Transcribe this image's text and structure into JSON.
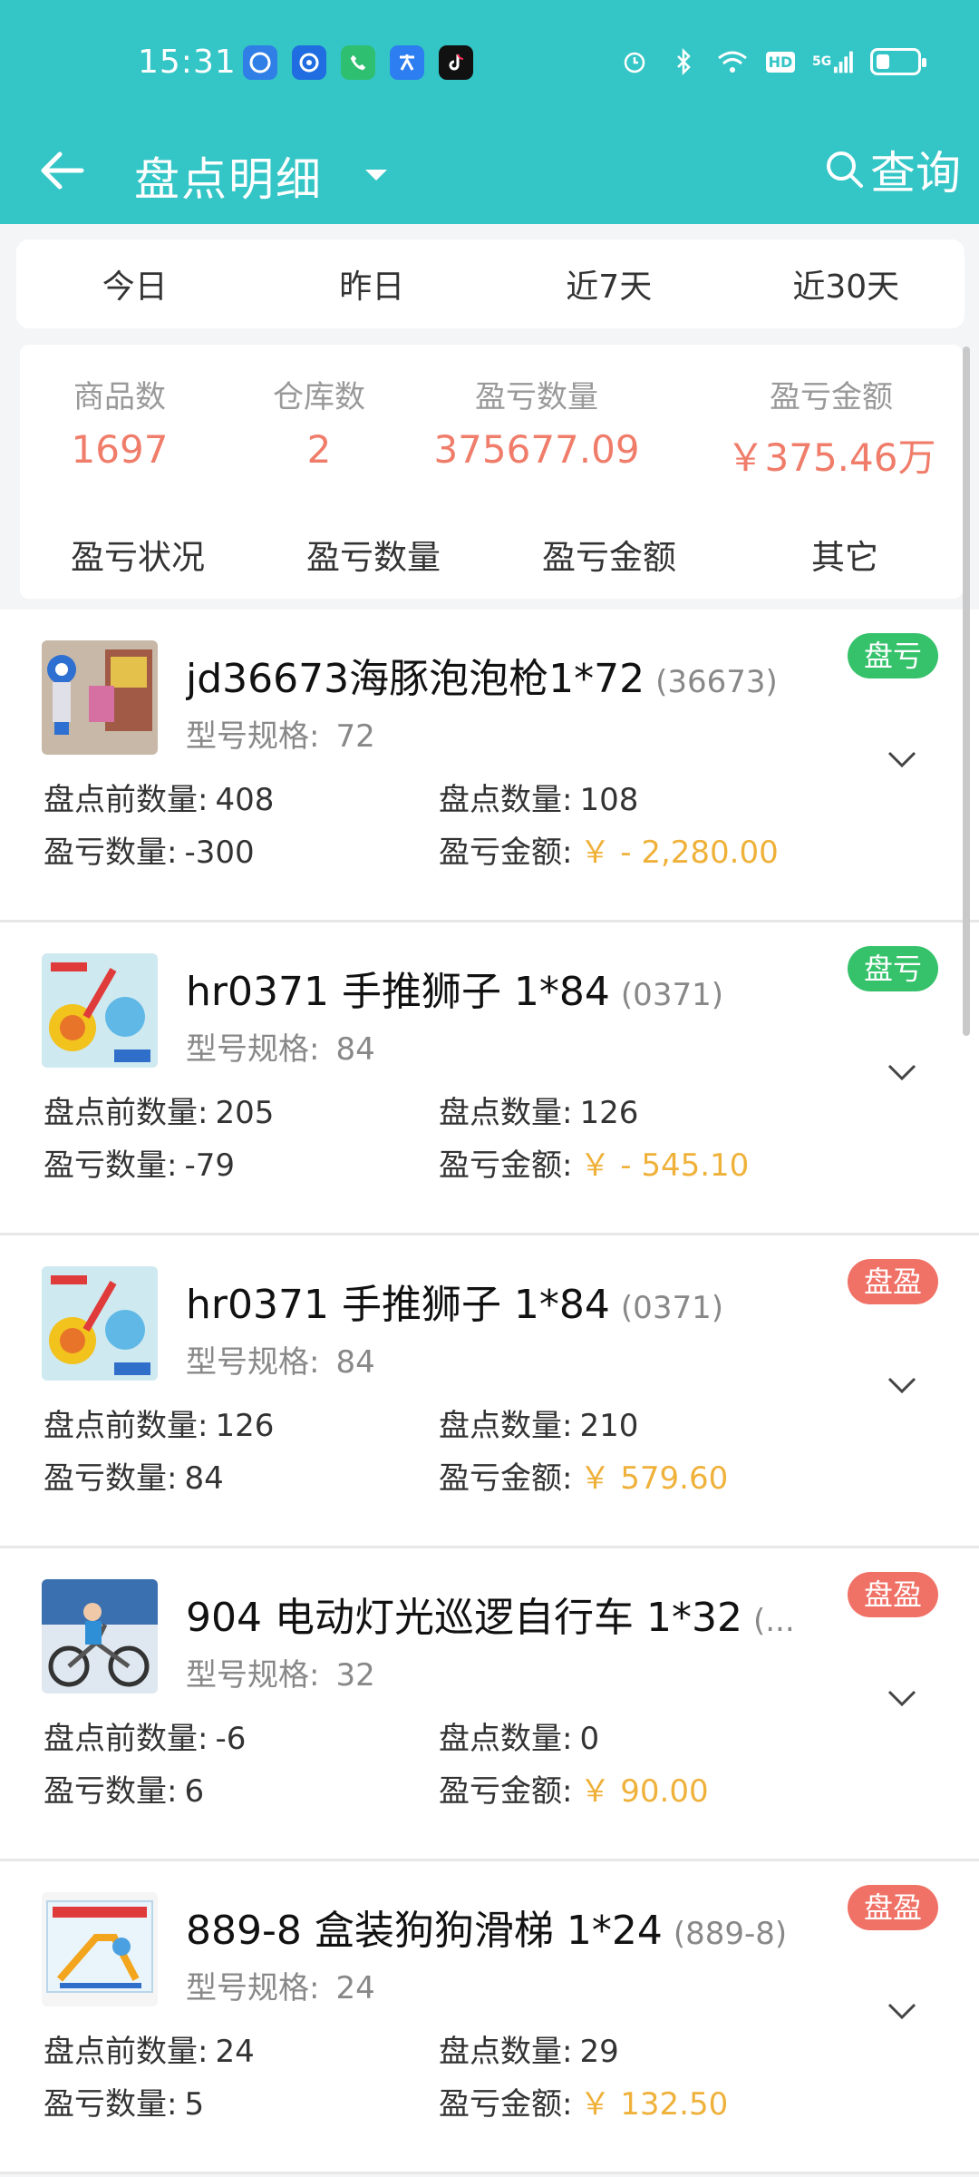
{
  "status_bar": {
    "time": "15:31",
    "app_icons": [
      "browser-icon",
      "browser-icon-2",
      "phone-icon",
      "translate-icon",
      "tiktok-icon"
    ],
    "right_icons": [
      "alarm-icon",
      "bluetooth-icon",
      "wifi-icon",
      "hd-icon",
      "signal-5g-icon",
      "battery-icon"
    ],
    "hd_label": "HD",
    "net_label": "5G"
  },
  "titlebar": {
    "title": "盘点明细",
    "query_label": "查询"
  },
  "date_tabs": [
    "今日",
    "昨日",
    "近7天",
    "近30天"
  ],
  "summary": {
    "stats": [
      {
        "label": "商品数",
        "value": "1697"
      },
      {
        "label": "仓库数",
        "value": "2"
      },
      {
        "label": "盈亏数量",
        "value": "375677.09"
      },
      {
        "label": "盈亏金额",
        "value": "￥375.46万"
      }
    ],
    "sort_options": [
      "盈亏状况",
      "盈亏数量",
      "盈亏金额",
      "其它"
    ]
  },
  "items": [
    {
      "name": "jd36673海豚泡泡枪1*72",
      "code": "(36673)",
      "spec_label": "型号规格:",
      "spec": "72",
      "before_label": "盘点前数量:",
      "before": "408",
      "counted_label": "盘点数量:",
      "counted": "108",
      "diff_label": "盈亏数量:",
      "diff": "-300",
      "amount_label": "盈亏金额:",
      "amount": "￥ - 2,280.00",
      "status": "盘亏",
      "status_type": "loss"
    },
    {
      "name": "hr0371 手推狮子 1*84",
      "code": "(0371)",
      "spec_label": "型号规格:",
      "spec": "84",
      "before_label": "盘点前数量:",
      "before": "205",
      "counted_label": "盘点数量:",
      "counted": "126",
      "diff_label": "盈亏数量:",
      "diff": "-79",
      "amount_label": "盈亏金额:",
      "amount": "￥ - 545.10",
      "status": "盘亏",
      "status_type": "loss"
    },
    {
      "name": "hr0371 手推狮子 1*84",
      "code": "(0371)",
      "spec_label": "型号规格:",
      "spec": "84",
      "before_label": "盘点前数量:",
      "before": "126",
      "counted_label": "盘点数量:",
      "counted": "210",
      "diff_label": "盈亏数量:",
      "diff": "84",
      "amount_label": "盈亏金额:",
      "amount": "￥ 579.60",
      "status": "盘盈",
      "status_type": "gain"
    },
    {
      "name": "904 电动灯光巡逻自行车 1*32",
      "code": "(...",
      "spec_label": "型号规格:",
      "spec": "32",
      "before_label": "盘点前数量:",
      "before": "-6",
      "counted_label": "盘点数量:",
      "counted": "0",
      "diff_label": "盈亏数量:",
      "diff": "6",
      "amount_label": "盈亏金额:",
      "amount": "￥ 90.00",
      "status": "盘盈",
      "status_type": "gain"
    },
    {
      "name": "889-8 盒装狗狗滑梯 1*24",
      "code": "(889-8)",
      "spec_label": "型号规格:",
      "spec": "24",
      "before_label": "盘点前数量:",
      "before": "24",
      "counted_label": "盘点数量:",
      "counted": "29",
      "diff_label": "盈亏数量:",
      "diff": "5",
      "amount_label": "盈亏金额:",
      "amount": "￥ 132.50",
      "status": "盘盈",
      "status_type": "gain"
    }
  ],
  "colors": {
    "header": "#34c5c6",
    "stat_value": "#f07c6a",
    "money": "#efb13a",
    "loss_badge": "#35c26b",
    "gain_badge": "#f07166"
  }
}
